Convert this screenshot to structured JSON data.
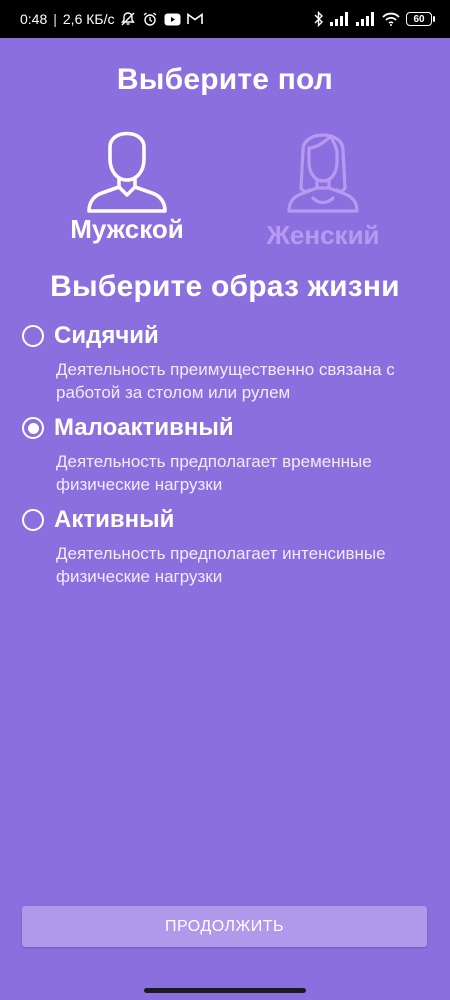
{
  "status_bar": {
    "time": "0:48",
    "speed": "2,6 КБ/с",
    "battery": "60",
    "icons": [
      "mute-bell-icon",
      "alarm-icon",
      "youtube-icon",
      "gmail-icon",
      "bluetooth-icon",
      "signal-icon",
      "signal-icon",
      "wifi-icon",
      "battery-icon"
    ]
  },
  "gender": {
    "title": "Выберите пол",
    "options": [
      {
        "label": "Мужской",
        "selected": true,
        "icon": "male-avatar-icon"
      },
      {
        "label": "Женский",
        "selected": false,
        "icon": "female-avatar-icon"
      }
    ]
  },
  "lifestyle": {
    "title": "Выберите образ жизни",
    "options": [
      {
        "label": "Сидячий",
        "description": "Деятельность преимущественно связана с работой за столом или рулем",
        "selected": false
      },
      {
        "label": "Малоактивный",
        "description": "Деятельность предполагает временные физические нагрузки",
        "selected": true
      },
      {
        "label": "Активный",
        "description": "Деятельность предполагает интенсивные физические нагрузки",
        "selected": false
      }
    ]
  },
  "continue_button": {
    "label": "ПРОДОЛЖИТЬ"
  },
  "colors": {
    "background": "#8b6fdf",
    "button": "#b098ea",
    "inactive": "#b79af0"
  }
}
